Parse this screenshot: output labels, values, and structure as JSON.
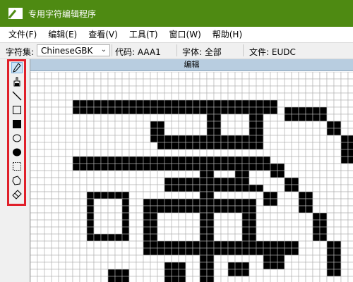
{
  "window": {
    "title": "专用字符编辑程序",
    "title_bar_color": "#4e8a12"
  },
  "menu": [
    {
      "label": "文件(F)"
    },
    {
      "label": "编辑(E)"
    },
    {
      "label": "查看(V)"
    },
    {
      "label": "工具(T)"
    },
    {
      "label": "窗口(W)"
    },
    {
      "label": "帮助(H)"
    }
  ],
  "infobar": {
    "charset_label": "字符集:",
    "charset_value": "ChineseGBK",
    "code": "代码: AAA1",
    "font": "字体: 全部",
    "file": "文件: EUDC"
  },
  "tools": [
    {
      "icon": "pencil-icon",
      "selected": true
    },
    {
      "icon": "brush-icon"
    },
    {
      "icon": "line-icon"
    },
    {
      "icon": "hollow-rectangle-icon"
    },
    {
      "icon": "filled-rectangle-icon"
    },
    {
      "icon": "hollow-ellipse-icon"
    },
    {
      "icon": "filled-ellipse-icon"
    },
    {
      "icon": "rectangle-select-icon"
    },
    {
      "icon": "freeform-select-icon"
    },
    {
      "icon": "eraser-icon"
    }
  ],
  "toolbox_highlight_color": "#e0202a",
  "editor": {
    "header": "编辑",
    "header_color": "#b8cde0"
  }
}
